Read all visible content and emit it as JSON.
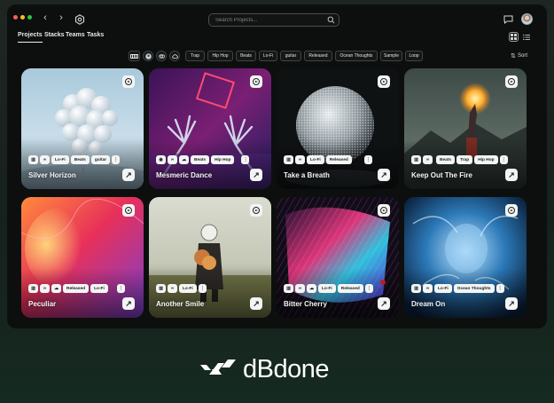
{
  "window": {
    "traffic_lights": {
      "close": "#ff5f57",
      "minimize": "#febc2e",
      "maximize": "#28c840"
    },
    "back_icon": "‹",
    "forward_icon": "›"
  },
  "search": {
    "placeholder": "Search Projects..."
  },
  "tabs": [
    {
      "label": "Projects",
      "active": true
    },
    {
      "label": "Stacks",
      "active": false
    },
    {
      "label": "Teams",
      "active": false
    },
    {
      "label": "Tasks",
      "active": false
    }
  ],
  "filters": {
    "icons": [
      "waveform-icon",
      "avatar-filter-icon",
      "link-icon",
      "cloud-icon"
    ],
    "chips": [
      "Trap",
      "Hip Hop",
      "Beats",
      "Lo-Fi",
      "guitar",
      "Released",
      "Ocean Thoughts",
      "Sample",
      "Loop"
    ],
    "sort_label": "Sort"
  },
  "projects": [
    {
      "title": "Silver Horizon",
      "tags": [
        "Lo-Fi",
        "Beats",
        "guitar"
      ]
    },
    {
      "title": "Mesmeric Dance",
      "tags": [
        "Beats",
        "Hip Hop"
      ]
    },
    {
      "title": "Take a Breath",
      "tags": [
        "Lo-Fi",
        "Released"
      ]
    },
    {
      "title": "Keep Out The Fire",
      "tags": [
        "Beats",
        "Trap",
        "Hip Hop"
      ]
    },
    {
      "title": "Peculiar",
      "tags": [
        "Released",
        "Lo-Fi"
      ]
    },
    {
      "title": "Another Smile",
      "tags": [
        "Lo-Fi"
      ]
    },
    {
      "title": "Bitter Cherry",
      "tags": [
        "Lo-Fi",
        "Released"
      ]
    },
    {
      "title": "Dream On",
      "tags": [
        "Lo-Fi",
        "Ocean Thoughts"
      ]
    }
  ],
  "more_label": "⋮",
  "open_label": "↗",
  "brand": {
    "name": "dBdone"
  }
}
